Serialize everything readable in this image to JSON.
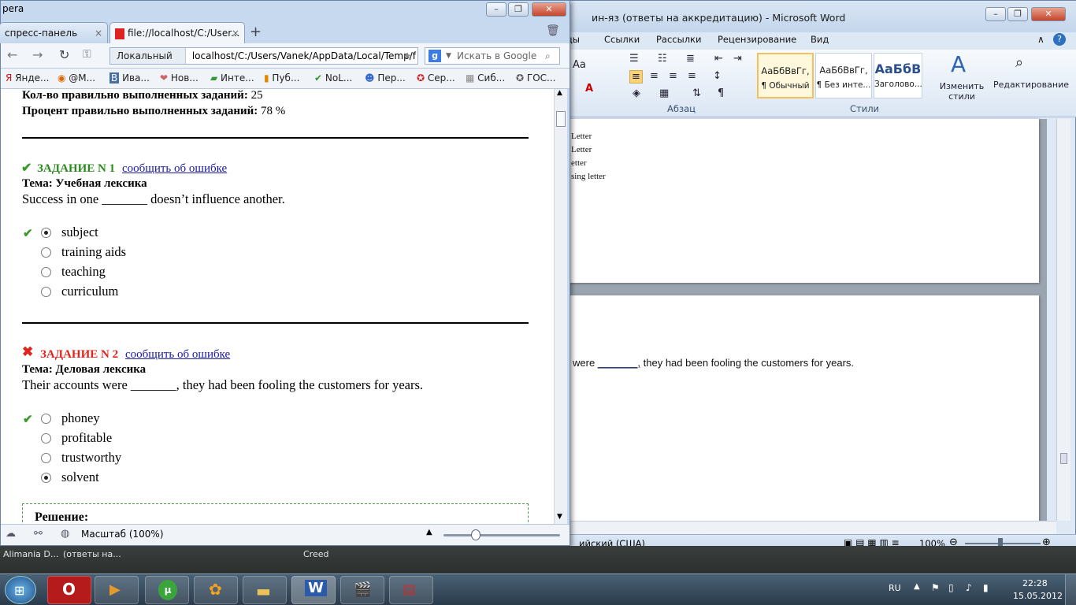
{
  "opera": {
    "corner_label": "pera",
    "tabs": [
      {
        "label": "спресс-панель"
      },
      {
        "label": "file://localhost/C:/User..."
      }
    ],
    "nav": {
      "local_label": "Локальный",
      "address": "localhost/C:/Users/Vanek/AppData/Local/Temp/f",
      "search_placeholder": "Искать в Google"
    },
    "bookmarks": [
      "Янде...",
      "@M...",
      "Ива...",
      "Нов...",
      "Инте...",
      "Пуб...",
      "NoL...",
      "Пер...",
      "Сер...",
      "Сиб...",
      "ГОС..."
    ],
    "page": {
      "summary": [
        {
          "label": "Кол-во правильно выполненных заданий:",
          "value": "25"
        },
        {
          "label": "Процент правильно выполненных заданий:",
          "value": "78 %"
        }
      ],
      "tasks": [
        {
          "title": "ЗАДАНИЕ N 1",
          "report_link": "сообщить об ошибке",
          "status": "correct",
          "topic_label": "Тема: Учебная лексика",
          "question": "Success in one _______ doesn’t influence another.",
          "options": [
            "subject",
            "training aids",
            "teaching",
            "curriculum"
          ],
          "selected_index": 0,
          "correct_index": 0
        },
        {
          "title": "ЗАДАНИЕ N 2",
          "report_link": "сообщить об ошибке",
          "status": "wrong",
          "topic_label": "Тема: Деловая лексика",
          "question": "Their accounts were _______, they had been fooling the customers for years.",
          "options": [
            "phoney",
            "profitable",
            "trustworthy",
            "solvent"
          ],
          "selected_index": 3,
          "correct_index": 0
        }
      ],
      "solution_label": "Решение:"
    },
    "status": {
      "zoom_label": "Масштаб (100%)"
    }
  },
  "word": {
    "title": "ин-яз (ответы на аккредитацию)  -  Microsoft Word",
    "tabs": [
      "цы",
      "Ссылки",
      "Рассылки",
      "Рецензирование",
      "Вид"
    ],
    "ribbon": {
      "font_fragment": "Aa",
      "paragraph_group": "Абзац",
      "styles_group": "Стили",
      "styles": [
        {
          "preview": "АаБбВвГг,",
          "name": "¶ Обычный"
        },
        {
          "preview": "АаБбВвГг,",
          "name": "¶ Без инте..."
        },
        {
          "preview": "АаБбВ",
          "name": "Заголово..."
        }
      ],
      "change_styles": "Изменить стили",
      "editing": "Редактирование"
    },
    "page1_lines": [
      "Letter",
      "Letter",
      "etter",
      "sing letter"
    ],
    "page2_line_before": "were ",
    "page2_blank": "_______,",
    "page2_line_after": " they had been fooling the customers for years.",
    "status": {
      "language": "ийский (США)",
      "zoom": "100%"
    }
  },
  "taskbar": {
    "strip": [
      "Alimania D...",
      "(ответы на...",
      "Creed"
    ],
    "tray": {
      "lang": "RU",
      "time": "22:28",
      "date": "15.05.2012"
    }
  },
  "colors": {
    "correct": "#2a8a1e",
    "wrong": "#e0241c",
    "link": "#1a1aa6"
  }
}
